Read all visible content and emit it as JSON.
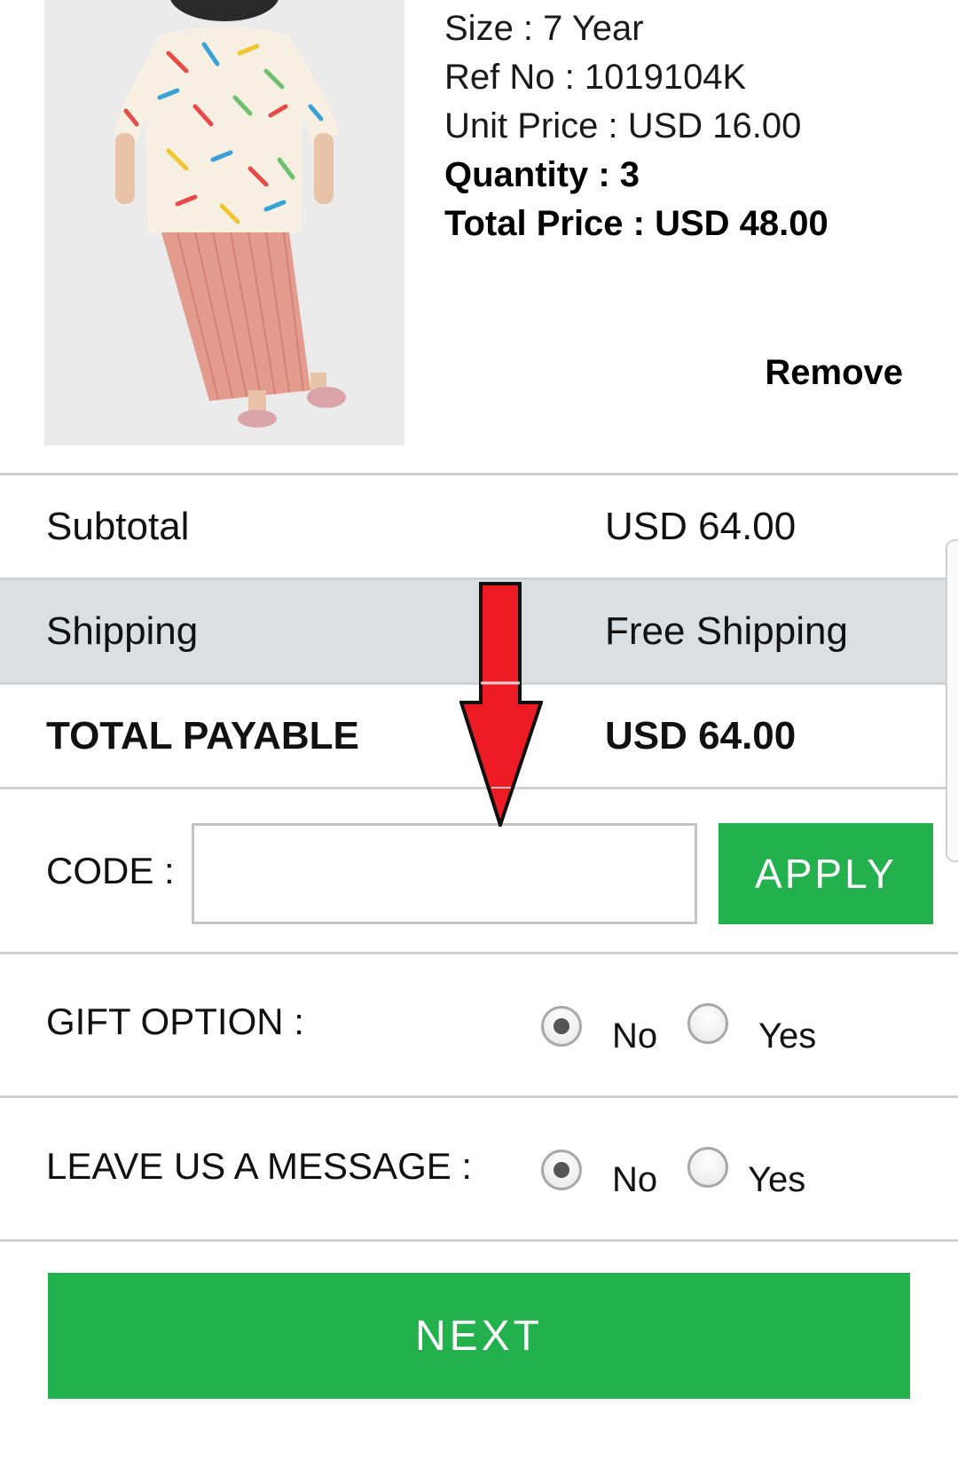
{
  "product": {
    "image_icon": "product-photo-icon",
    "size": "Size : 7 Year",
    "ref_no": "Ref No : 1019104K",
    "unit_price": "Unit Price : USD 16.00",
    "quantity": "Quantity : 3",
    "total_price": "Total Price : USD 48.00",
    "remove_label": "Remove"
  },
  "summary": {
    "subtotal_label": "Subtotal",
    "subtotal_value": "USD 64.00",
    "shipping_label": "Shipping",
    "shipping_value": "Free Shipping",
    "total_label": "TOTAL PAYABLE",
    "total_value": "USD 64.00"
  },
  "code": {
    "label": "CODE :",
    "value": "",
    "apply_label": "APPLY"
  },
  "gift_option": {
    "label": "GIFT OPTION :",
    "no_label": "No",
    "yes_label": "Yes",
    "selected": "No"
  },
  "message_option": {
    "label": "LEAVE US A MESSAGE :",
    "no_label": "No",
    "yes_label": "Yes",
    "selected": "No"
  },
  "next_label": "NEXT",
  "colors": {
    "accent_green": "#22b14c",
    "shaded_row": "#dcdfe2",
    "arrow_red": "#ed1c24"
  },
  "annotation_icon": "red-down-arrow-icon"
}
